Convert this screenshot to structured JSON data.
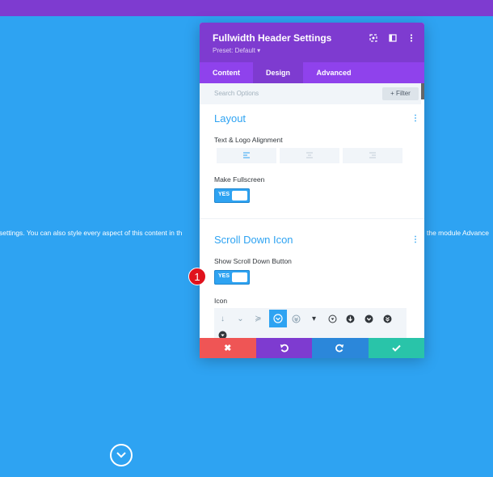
{
  "background": {
    "text_left": "settings. You can also style every aspect of this content in th",
    "text_right": "the module Advance",
    "scroll_icon": "circle-chevron-down-icon"
  },
  "modal": {
    "title": "Fullwidth Header Settings",
    "preset": "Preset: Default ▾",
    "header_icons": [
      "focus-icon",
      "sidebar-icon",
      "more-icon"
    ],
    "tabs": [
      {
        "label": "Content",
        "active": false
      },
      {
        "label": "Design",
        "active": true
      },
      {
        "label": "Advanced",
        "active": false
      }
    ],
    "search": {
      "placeholder": "Search Options",
      "filter_label": "+ Filter"
    },
    "sections": {
      "layout": {
        "title": "Layout",
        "alignment_label": "Text & Logo Alignment",
        "alignment_options": [
          "left",
          "center",
          "right"
        ],
        "fullscreen_label": "Make Fullscreen",
        "fullscreen_toggle": "YES"
      },
      "scroll": {
        "title": "Scroll Down Icon",
        "show_label": "Show Scroll Down Button",
        "show_toggle": "YES",
        "icon_label": "Icon",
        "icons": [
          "↓",
          "⌄",
          "≽",
          "⌄",
          "≽",
          "▾",
          "▾",
          "▾",
          "▾",
          "▾",
          "▾"
        ]
      }
    },
    "footer": [
      "cancel",
      "undo",
      "redo",
      "save"
    ]
  },
  "badge": "1",
  "colors": {
    "page_bg": "#2ea3f2",
    "purple_dark": "#7e3bd0",
    "purple_light": "#8f42ec",
    "cancel": "#ef5555",
    "undo": "#7e3bd0",
    "redo": "#2b87da",
    "save": "#29c4a9"
  }
}
